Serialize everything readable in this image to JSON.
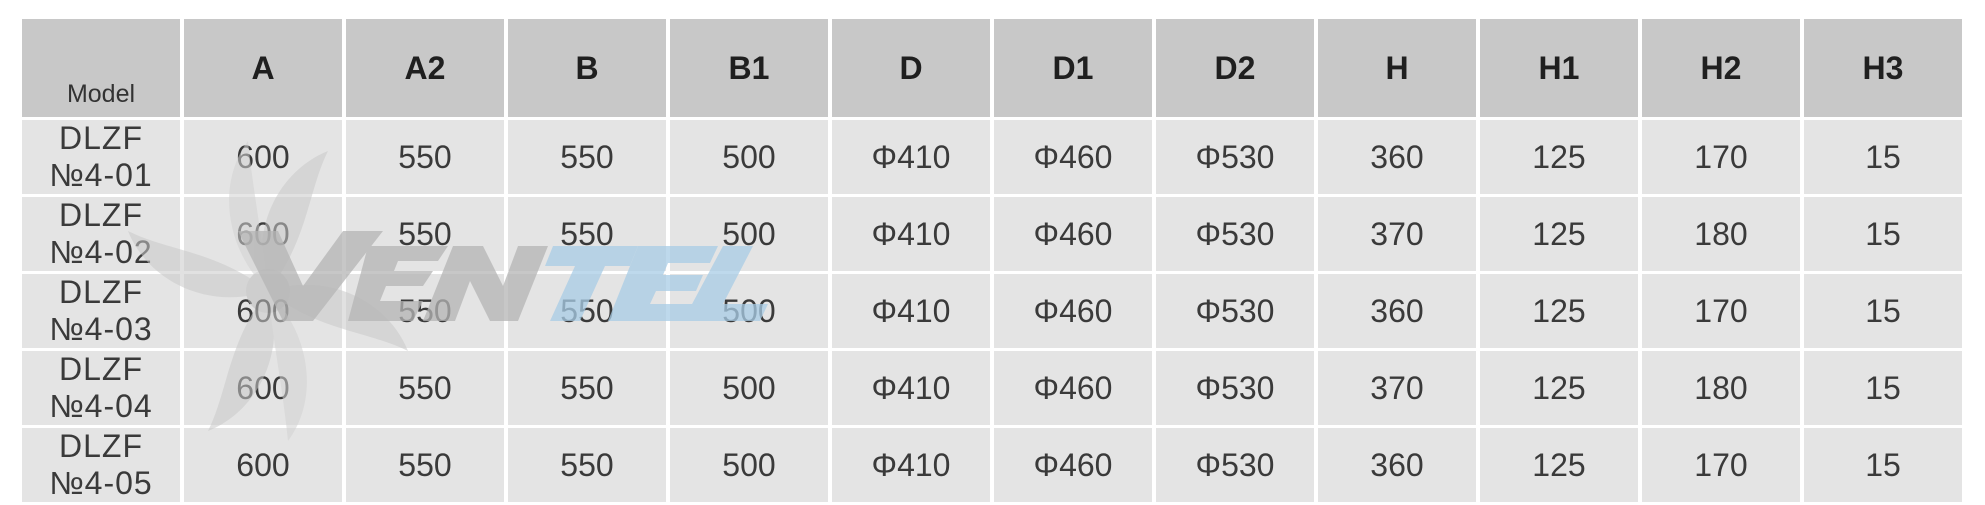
{
  "table": {
    "headers": [
      "Model",
      "A",
      "A2",
      "B",
      "B1",
      "D",
      "D1",
      "D2",
      "H",
      "H1",
      "H2",
      "H3"
    ],
    "rows": [
      [
        "DLZF №4-01",
        "600",
        "550",
        "550",
        "500",
        "Φ410",
        "Φ460",
        "Φ530",
        "360",
        "125",
        "170",
        "15"
      ],
      [
        "DLZF №4-02",
        "600",
        "550",
        "550",
        "500",
        "Φ410",
        "Φ460",
        "Φ530",
        "370",
        "125",
        "180",
        "15"
      ],
      [
        "DLZF №4-03",
        "600",
        "550",
        "550",
        "500",
        "Φ410",
        "Φ460",
        "Φ530",
        "360",
        "125",
        "170",
        "15"
      ],
      [
        "DLZF №4-04",
        "600",
        "550",
        "550",
        "500",
        "Φ410",
        "Φ460",
        "Φ530",
        "370",
        "125",
        "180",
        "15"
      ],
      [
        "DLZF №4-05",
        "600",
        "550",
        "550",
        "500",
        "Φ410",
        "Φ460",
        "Φ530",
        "360",
        "125",
        "170",
        "15"
      ]
    ]
  },
  "watermark": {
    "text": "Ventel",
    "icon": "fan-icon",
    "colors": {
      "dark": "#b5b5b5",
      "blue": "#a9cde6"
    }
  },
  "colors": {
    "header_bg": "#c8c8c8",
    "cell_bg": "#e4e4e4"
  }
}
